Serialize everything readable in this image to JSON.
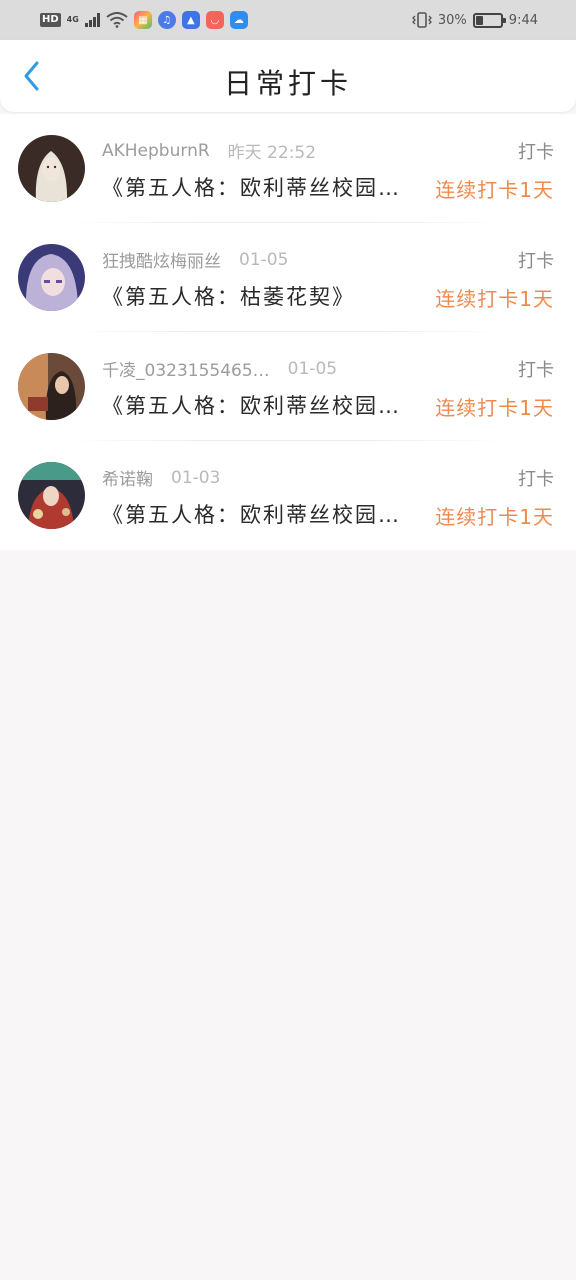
{
  "status_bar": {
    "hd": "HD",
    "network": "4G",
    "battery_percent": "30%",
    "time": "9:44",
    "battery_level": 0.3
  },
  "header": {
    "title": "日常打卡",
    "back_icon": "chevron-left-icon"
  },
  "colors": {
    "accent_blue": "#2d9be6",
    "streak_orange": "#ef8a4f",
    "page_bg": "#f8f6f7"
  },
  "entries": [
    {
      "name": "AKHepburnR",
      "time": "昨天 22:52",
      "tag": "打卡",
      "book": "《第五人格：欧利蒂丝校园…",
      "streak": "连续打卡1天"
    },
    {
      "name": "狂拽酷炫梅丽丝",
      "time": "01-05",
      "tag": "打卡",
      "book": "《第五人格：枯萎花契》",
      "streak": "连续打卡1天"
    },
    {
      "name": "千凌_0323155465…",
      "time": "01-05",
      "tag": "打卡",
      "book": "《第五人格：欧利蒂丝校园…",
      "streak": "连续打卡1天"
    },
    {
      "name": "希诺鞠",
      "time": "01-03",
      "tag": "打卡",
      "book": "《第五人格：欧利蒂丝校园…",
      "streak": "连续打卡1天"
    }
  ]
}
